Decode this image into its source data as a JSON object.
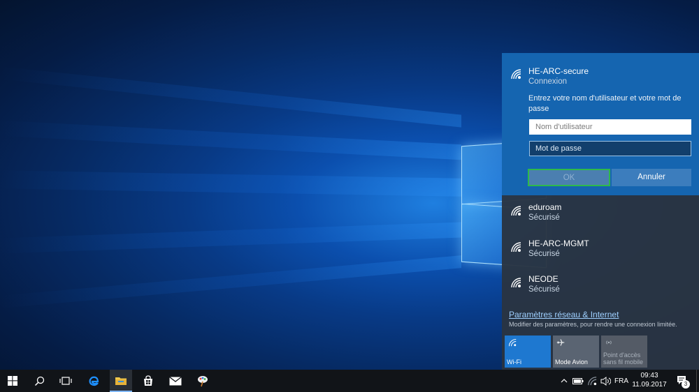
{
  "flyout": {
    "active_network": {
      "name": "HE-ARC-secure",
      "status": "Connexion",
      "prompt": "Entrez votre nom d'utilisateur et votre mot de passe",
      "username_placeholder": "Nom d'utilisateur",
      "password_placeholder": "Mot de passe",
      "ok_label": "OK",
      "cancel_label": "Annuler"
    },
    "networks": [
      {
        "name": "eduroam",
        "status": "Sécurisé"
      },
      {
        "name": "HE-ARC-MGMT",
        "status": "Sécurisé"
      },
      {
        "name": "NEODE",
        "status": "Sécurisé"
      }
    ],
    "settings_link": "Paramètres réseau & Internet",
    "settings_desc": "Modifier des paramètres, pour rendre une connexion limitée.",
    "quick_actions": [
      {
        "label": "Wi-Fi",
        "icon": "wifi-icon",
        "state": "on"
      },
      {
        "label": "Mode Avion",
        "icon": "airplane-icon",
        "state": "off"
      },
      {
        "label_line1": "Point d'accès",
        "label_line2": "sans fil mobile",
        "icon": "hotspot-icon",
        "state": "disabled"
      }
    ]
  },
  "taskbar": {
    "language": "FRA",
    "time": "09:43",
    "date": "11.09.2017",
    "notification_count": "3",
    "pinned": [
      "windows-start-icon",
      "search-icon",
      "task-view-icon",
      "edge-icon",
      "file-explorer-icon",
      "store-icon",
      "mail-icon",
      "paint-icon"
    ]
  },
  "colors": {
    "accent": "#1565b0",
    "flyout_bg": "#2a3442",
    "taskbar_bg": "#111418",
    "ok_focus_border": "#2fb94a"
  }
}
